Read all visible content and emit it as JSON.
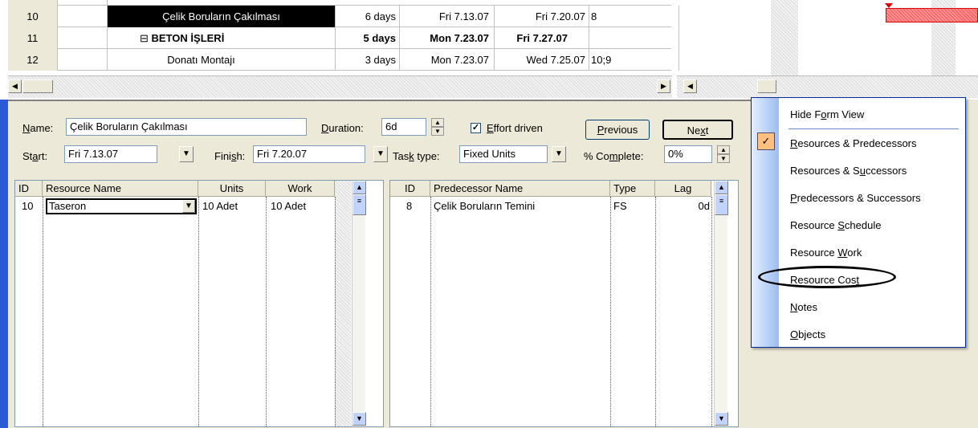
{
  "gantt_table": {
    "rows": [
      {
        "id": "10",
        "name": "Çelik Boruların Çakılması",
        "duration": "6 days",
        "start": "Fri 7.13.07",
        "finish": "Fri 7.20.07",
        "predecessors": "8"
      },
      {
        "id": "11",
        "name": "BETON İŞLERİ",
        "duration": "5 days",
        "start": "Mon 7.23.07",
        "finish": "Fri 7.27.07",
        "predecessors": "",
        "summary_icon": "⊟"
      },
      {
        "id": "12",
        "name": "Donatı Montajı",
        "duration": "3 days",
        "start": "Mon 7.23.07",
        "finish": "Wed 7.25.07",
        "predecessors": "10;9"
      }
    ]
  },
  "task_form": {
    "name_label_u": "N",
    "name_label_rest": "ame:",
    "name_value": "Çelik Boruların Çakılması",
    "duration_label_u": "D",
    "duration_label_rest": "uration:",
    "duration_value": "6d",
    "effort_driven_label_u": "E",
    "effort_driven_label_rest": "ffort driven",
    "effort_driven_checked": true,
    "previous_label_u": "P",
    "previous_label_rest": "revious",
    "next_label_pre": "Ne",
    "next_label_u": "x",
    "next_label_rest": "t",
    "start_label_pre": "St",
    "start_label_u": "a",
    "start_label_rest": "rt:",
    "start_value": "Fri 7.13.07",
    "finish_label_pre": "Fini",
    "finish_label_u": "s",
    "finish_label_rest": "h:",
    "finish_value": "Fri 7.20.07",
    "task_type_label_pre": "Tas",
    "task_type_label_u": "k",
    "task_type_label_rest": " type:",
    "task_type_value": "Fixed Units",
    "complete_label_pre": "% Co",
    "complete_label_u": "m",
    "complete_label_rest": "plete:",
    "complete_value": "0%"
  },
  "resources_grid": {
    "headers": [
      "ID",
      "Resource Name",
      "Units",
      "Work"
    ],
    "rows": [
      {
        "id": "10",
        "name": "Taseron",
        "units": "10 Adet",
        "work": "10 Adet"
      }
    ]
  },
  "predecessors_grid": {
    "headers": [
      "ID",
      "Predecessor Name",
      "Type",
      "Lag"
    ],
    "rows": [
      {
        "id": "8",
        "name": "Çelik Boruların Temini",
        "type": "FS",
        "lag": "0d"
      }
    ]
  },
  "context_menu": {
    "items": [
      {
        "pre": "Hide F",
        "u": "o",
        "rest": "rm View"
      },
      {
        "pre": "",
        "u": "R",
        "rest": "esources & Predecessors",
        "checked": true
      },
      {
        "pre": "Resources & S",
        "u": "u",
        "rest": "ccessors"
      },
      {
        "pre": "",
        "u": "P",
        "rest": "redecessors & Successors"
      },
      {
        "pre": "Resource ",
        "u": "S",
        "rest": "chedule"
      },
      {
        "pre": "Resource ",
        "u": "W",
        "rest": "ork"
      },
      {
        "pre": "Resource Cos",
        "u": "t",
        "rest": ""
      },
      {
        "pre": "",
        "u": "N",
        "rest": "otes"
      },
      {
        "pre": "",
        "u": "O",
        "rest": "bjects"
      }
    ]
  },
  "colors": {
    "accent_blue": "#2a5bd7",
    "gantt_bar": "#ff6666",
    "menu_highlight": "#ffc080"
  }
}
